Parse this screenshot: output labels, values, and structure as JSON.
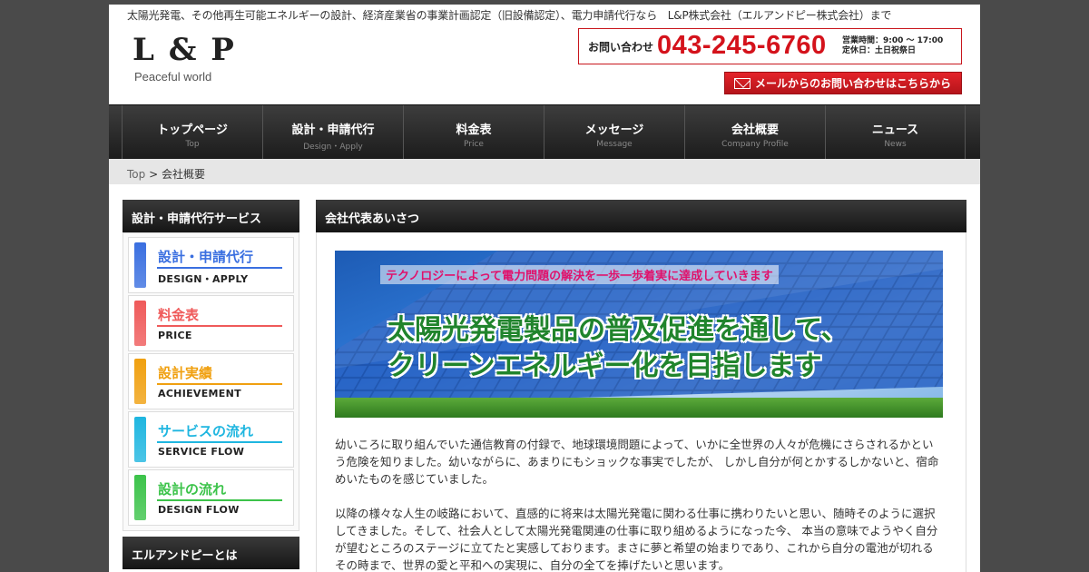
{
  "header": {
    "tagline": "太陽光発電、その他再生可能エネルギーの設計、経済産業省の事業計画認定（旧設備認定）、電力申請代行なら　L&P株式会社（エルアンドピー株式会社）まで",
    "logo": "L & P",
    "logo_sub": "Peaceful world",
    "contact_label": "お問い合わせ",
    "phone": "043-245-6760",
    "hours": "営業時間：9:00 〜 17:00",
    "closed": "定休日：土日祝祭日",
    "mail_button": "メールからのお問い合わせはこちらから",
    "mail_icon": "mail-icon"
  },
  "nav": [
    {
      "jp": "トップページ",
      "en": "Top"
    },
    {
      "jp": "設計・申請代行",
      "en": "Design・Apply"
    },
    {
      "jp": "料金表",
      "en": "Price"
    },
    {
      "jp": "メッセージ",
      "en": "Message"
    },
    {
      "jp": "会社概要",
      "en": "Company Profile"
    },
    {
      "jp": "ニュース",
      "en": "News"
    }
  ],
  "breadcrumb": {
    "home": "Top",
    "separator": " > ",
    "current": "会社概要"
  },
  "sidebar": {
    "heading": "設計・申請代行サービス",
    "items": [
      {
        "jp": "設計・申請代行",
        "en": "DESIGN・APPLY",
        "color": "#3a6fe0"
      },
      {
        "jp": "料金表",
        "en": "PRICE",
        "color": "#ef5a5a"
      },
      {
        "jp": "設計実績",
        "en": "ACHIEVEMENT",
        "color": "#f0a010"
      },
      {
        "jp": "サービスの流れ",
        "en": "SERVICE FLOW",
        "color": "#1fb6e0"
      },
      {
        "jp": "設計の流れ",
        "en": "DESIGN FLOW",
        "color": "#3cc34a"
      }
    ],
    "heading2": "エルアンドピーとは"
  },
  "main": {
    "heading": "会社代表あいさつ",
    "banner_small": "テクノロジーによって電力問題の解決を一歩一歩着実に達成していきます",
    "banner_line1": "太陽光発電製品の普及促進を通して、",
    "banner_line2": "クリーンエネルギー化を目指します",
    "paragraph1": "幼いころに取り組んでいた通信教育の付録で、地球環境問題によって、いかに全世界の人々が危機にさらされるかという危険を知りました。幼いながらに、あまりにもショックな事実でしたが、 しかし自分が何とかするしかないと、宿命めいたものを感じていました。",
    "paragraph2": "以降の様々な人生の岐路において、直感的に将来は太陽光発電に関わる仕事に携わりたいと思い、随時そのように選択してきました。そして、社会人として太陽光発電関連の仕事に取り組めるようになった今、 本当の意味でようやく自分が望むところのステージに立てたと実感しております。まさに夢と希望の始まりであり、これから自分の電池が切れるその時まで、世界の愛と平和への実現に、自分の全てを捧げたいと思います。"
  }
}
